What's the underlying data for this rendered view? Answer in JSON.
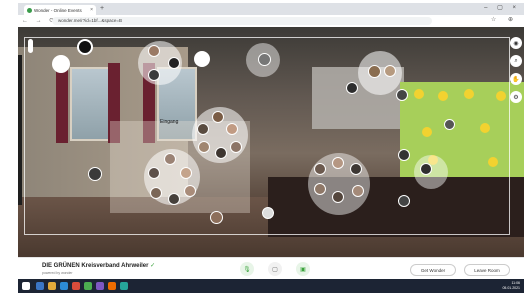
{
  "browser": {
    "tab_title": "Wonder - Online Events",
    "tab_close": "×",
    "new_tab": "+",
    "window_controls": "– ▢ ×",
    "nav": "← → ⟳",
    "url": "wonder.me/r?id=1bf...&space=B",
    "address_icons": "☆ ⊕"
  },
  "space": {
    "circle_label": "Eingang",
    "tools": [
      "person-icon",
      "search-icon",
      "hand-icon",
      "settings-icon"
    ]
  },
  "bottom": {
    "org_name_bold": "DIE GRÜNEN",
    "org_name_rest": " Kreisverband Ahrweiler",
    "org_extra": "✓",
    "powered_by": "powered by wonder",
    "get_wonder": "Get Wonder",
    "leave_room": "Leave Room"
  },
  "taskbar": {
    "time": "11:06",
    "date": "05.01.2021"
  },
  "colors": {
    "accent": "#3aa33c",
    "taskbar": "#1c2434"
  }
}
